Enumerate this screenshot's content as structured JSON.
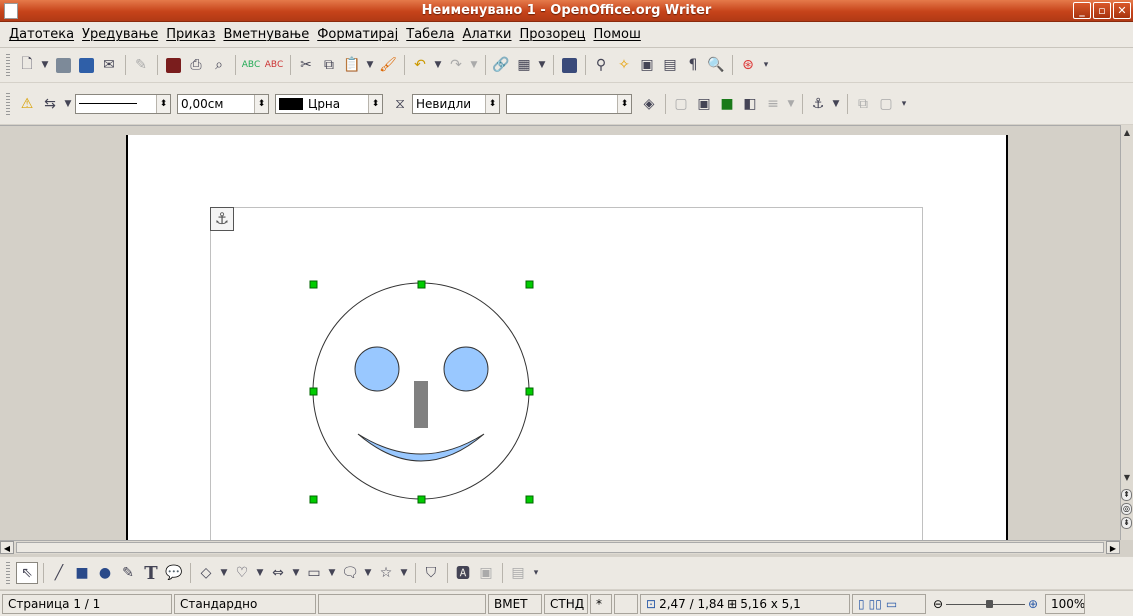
{
  "window": {
    "title": "Неименувано 1 - OpenOffice.org Writer",
    "minimize_icon": "minimize-icon",
    "maximize_icon": "maximize-icon",
    "close_icon": "close-icon"
  },
  "menu": {
    "items": [
      "Датотека",
      "Уредување",
      "Приказ",
      "Вметнување",
      "Форматирај",
      "Табела",
      "Алатки",
      "Прозорец",
      "Помош"
    ]
  },
  "format_toolbar": {
    "line_width_value": "0,00см",
    "line_color_value": "Црна",
    "area_style_value": "Невидли",
    "area_fill_value": ""
  },
  "statusbar": {
    "page": "Страница 1 / 1",
    "style": "Стандардно",
    "language": "",
    "insert_mode": "ВМЕТ",
    "selection_mode": "СТНД",
    "modified": "*",
    "position": "2,47 / 1,84",
    "size": "5,16 x 5,1",
    "zoom": "100%"
  },
  "drawing": {
    "face_color": "#ffffff",
    "feature_color": "#99c8ff",
    "nose_color": "#808080",
    "handle_color": "#00cc00"
  }
}
